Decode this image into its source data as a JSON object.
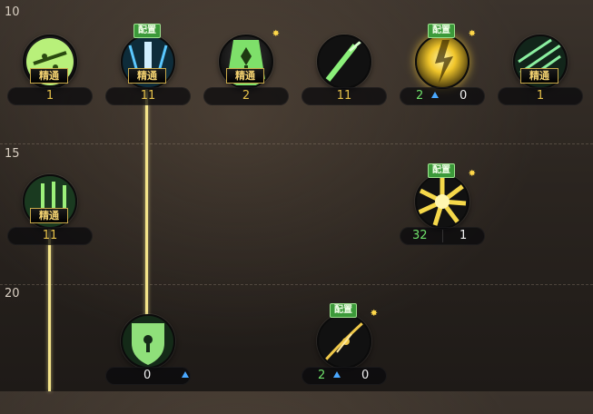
{
  "levels": [
    "10",
    "15",
    "20"
  ],
  "badge_label": "配置",
  "master_label": "精通",
  "skills": {
    "s10_1": {
      "value": "1"
    },
    "s10_2": {
      "value": "11"
    },
    "s10_3": {
      "value": "2"
    },
    "s10_4": {
      "value": "11"
    },
    "s10_5": {
      "left": "2",
      "right": "0"
    },
    "s10_6": {
      "value": "1"
    },
    "s15_1": {
      "value": "11"
    },
    "s15_2": {
      "left": "32",
      "right": "1"
    },
    "s20_1": {
      "value": "0"
    },
    "s20_2": {
      "left": "2",
      "right": "0"
    }
  },
  "colors": {
    "connector": "#f4e48a",
    "badge_green": "#3c9a3a",
    "gold": "#e7c24a",
    "green_num": "#6fe06a"
  }
}
